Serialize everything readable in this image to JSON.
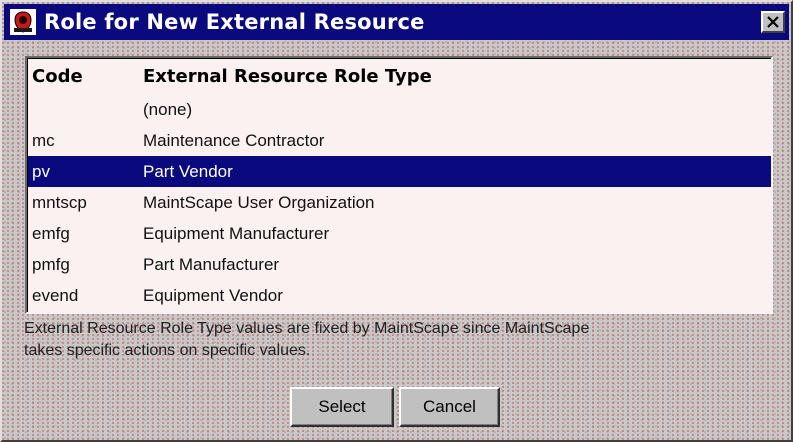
{
  "window": {
    "title": "Role for New External Resource",
    "icon": "app-shield-icon",
    "close_icon": "close-x-icon"
  },
  "list": {
    "headers": {
      "code": "Code",
      "type": "External Resource Role Type"
    },
    "rows": [
      {
        "code": "",
        "type": "(none)",
        "selected": false
      },
      {
        "code": "mc",
        "type": "Maintenance Contractor",
        "selected": false
      },
      {
        "code": "pv",
        "type": "Part Vendor",
        "selected": true
      },
      {
        "code": "mntscp",
        "type": "MaintScape User Organization",
        "selected": false
      },
      {
        "code": "emfg",
        "type": "Equipment Manufacturer",
        "selected": false
      },
      {
        "code": "pmfg",
        "type": "Part Manufacturer",
        "selected": false
      },
      {
        "code": "evend",
        "type": "Equipment Vendor",
        "selected": false
      }
    ]
  },
  "note": {
    "line1": "External Resource Role Type values are fixed by MaintScape since MaintScape",
    "line2": "takes specific actions on specific values."
  },
  "buttons": {
    "select": "Select",
    "cancel": "Cancel"
  },
  "colors": {
    "titlebar": "#0a0a7e",
    "selection": "#0a0a7e",
    "list_background": "#fbf1f1"
  }
}
